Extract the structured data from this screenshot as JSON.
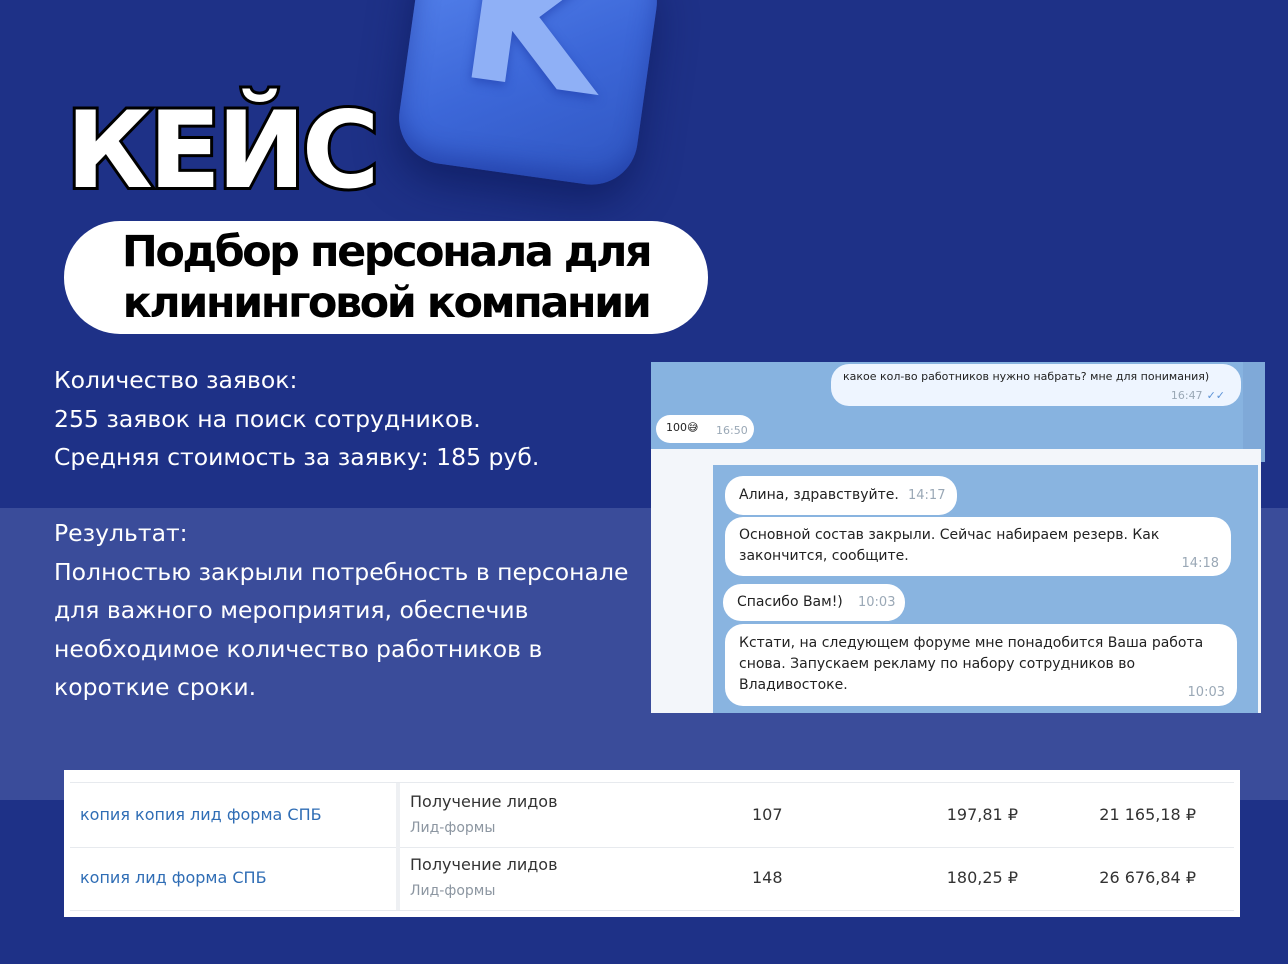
{
  "logo": {
    "glyph": "K",
    "icon": "vk-logo-icon"
  },
  "title": "КЕЙС",
  "subtitle": {
    "line1": "Подбор персонала для",
    "line2": "клининговой компании"
  },
  "stats": [
    "Количество заявок:",
    "255 заявок на поиск сотрудников.",
    "Средняя стоимость за заявку: 185 руб."
  ],
  "result": [
    "Результат:",
    "Полностью закрыли потребность в персонале",
    "для важного мероприятия, обеспечив",
    "необходимое количество работников в",
    "короткие сроки."
  ],
  "chat_top": {
    "outgoing": {
      "text": "какое кол-во работников нужно набрать? мне для понимания)",
      "time": "16:47",
      "read_icon": "double-check-icon"
    },
    "incoming": {
      "text": "100😅",
      "time": "16:50"
    }
  },
  "chat_bottom": [
    {
      "text": "Алина, здравствуйте.",
      "time": "14:17"
    },
    {
      "line1": "Основной состав закрыли. Сейчас набираем резерв. Как",
      "line2": "закончится, сообщите.",
      "time": "14:18"
    },
    {
      "text": "Спасибо Вам!)",
      "time": "10:03"
    },
    {
      "line1": "Кстати, на следующем форуме мне понадобится Ваша работа",
      "line2": "снова. Запускаем рекламу по набору сотрудников во",
      "line3": "Владивостоке.",
      "time": "10:03"
    }
  ],
  "table": {
    "rows": [
      {
        "name": "копия копия лид форма СПБ",
        "goal": "Получение лидов",
        "sub": "Лид-формы",
        "leads": "107",
        "cpl": "197,81 ₽",
        "total": "21 165,18 ₽"
      },
      {
        "name": "копия лид форма СПБ",
        "goal": "Получение лидов",
        "sub": "Лид-формы",
        "leads": "148",
        "cpl": "180,25 ₽",
        "total": "26 676,84 ₽"
      }
    ]
  },
  "colors": {
    "background": "#1e3187",
    "band": "#3a4c9a",
    "chat": "#89b4e0",
    "link": "#2f6db5"
  }
}
